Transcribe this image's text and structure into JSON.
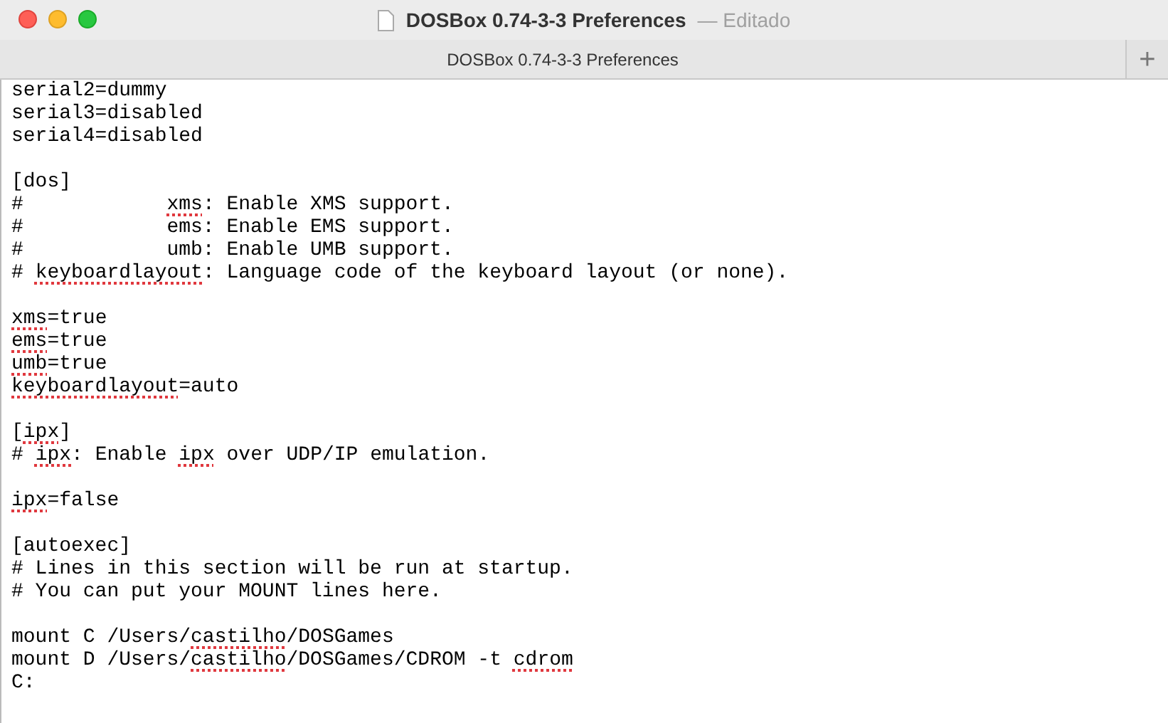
{
  "window": {
    "title": "DOSBox 0.74-3-3 Preferences",
    "edited_label": "— Editado"
  },
  "tabs": [
    {
      "label": "DOSBox 0.74-3-3 Preferences",
      "selected": true
    }
  ],
  "new_tab_button": "+",
  "editor": {
    "lines": [
      {
        "kind": "text",
        "segments": [
          {
            "text": "serial2=dummy",
            "misspelled": false
          }
        ]
      },
      {
        "kind": "text",
        "segments": [
          {
            "text": "serial3=disabled",
            "misspelled": false
          }
        ]
      },
      {
        "kind": "text",
        "segments": [
          {
            "text": "serial4=disabled",
            "misspelled": false
          }
        ]
      },
      {
        "kind": "blank"
      },
      {
        "kind": "text",
        "segments": [
          {
            "text": "[dos]",
            "misspelled": false
          }
        ]
      },
      {
        "kind": "text",
        "segments": [
          {
            "text": "#            ",
            "misspelled": false
          },
          {
            "text": "xms",
            "misspelled": true
          },
          {
            "text": ": Enable XMS support.",
            "misspelled": false
          }
        ]
      },
      {
        "kind": "text",
        "segments": [
          {
            "text": "#            ems: Enable EMS support.",
            "misspelled": false
          }
        ]
      },
      {
        "kind": "text",
        "segments": [
          {
            "text": "#            umb: Enable UMB support.",
            "misspelled": false
          }
        ]
      },
      {
        "kind": "text",
        "segments": [
          {
            "text": "# ",
            "misspelled": false
          },
          {
            "text": "keyboardlayout",
            "misspelled": true
          },
          {
            "text": ": Language code of the keyboard layout (or none).",
            "misspelled": false
          }
        ]
      },
      {
        "kind": "blank"
      },
      {
        "kind": "text",
        "segments": [
          {
            "text": "xms",
            "misspelled": true
          },
          {
            "text": "=true",
            "misspelled": false
          }
        ]
      },
      {
        "kind": "text",
        "segments": [
          {
            "text": "ems",
            "misspelled": true
          },
          {
            "text": "=true",
            "misspelled": false
          }
        ]
      },
      {
        "kind": "text",
        "segments": [
          {
            "text": "umb",
            "misspelled": true
          },
          {
            "text": "=true",
            "misspelled": false
          }
        ]
      },
      {
        "kind": "text",
        "segments": [
          {
            "text": "keyboardlayout",
            "misspelled": true
          },
          {
            "text": "=auto",
            "misspelled": false
          }
        ]
      },
      {
        "kind": "blank"
      },
      {
        "kind": "text",
        "segments": [
          {
            "text": "[",
            "misspelled": false
          },
          {
            "text": "ipx",
            "misspelled": true
          },
          {
            "text": "]",
            "misspelled": false
          }
        ]
      },
      {
        "kind": "text",
        "segments": [
          {
            "text": "# ",
            "misspelled": false
          },
          {
            "text": "ipx",
            "misspelled": true
          },
          {
            "text": ": Enable ",
            "misspelled": false
          },
          {
            "text": "ipx",
            "misspelled": true
          },
          {
            "text": " over UDP/IP emulation.",
            "misspelled": false
          }
        ]
      },
      {
        "kind": "blank"
      },
      {
        "kind": "text",
        "segments": [
          {
            "text": "ipx",
            "misspelled": true
          },
          {
            "text": "=false",
            "misspelled": false
          }
        ]
      },
      {
        "kind": "blank"
      },
      {
        "kind": "text",
        "segments": [
          {
            "text": "[autoexec]",
            "misspelled": false
          }
        ]
      },
      {
        "kind": "text",
        "segments": [
          {
            "text": "# Lines in this section will be run at startup.",
            "misspelled": false
          }
        ]
      },
      {
        "kind": "text",
        "segments": [
          {
            "text": "# You can put your MOUNT lines here.",
            "misspelled": false
          }
        ]
      },
      {
        "kind": "blank"
      },
      {
        "kind": "text",
        "segments": [
          {
            "text": "mount C /Users/",
            "misspelled": false
          },
          {
            "text": "castilho",
            "misspelled": true
          },
          {
            "text": "/DOSGames",
            "misspelled": false
          }
        ]
      },
      {
        "kind": "text",
        "segments": [
          {
            "text": "mount D /Users/",
            "misspelled": false
          },
          {
            "text": "castilho",
            "misspelled": true
          },
          {
            "text": "/DOSGames/CDROM -t ",
            "misspelled": false
          },
          {
            "text": "cdrom",
            "misspelled": true
          }
        ]
      },
      {
        "kind": "text",
        "segments": [
          {
            "text": "C:",
            "misspelled": false
          }
        ]
      }
    ]
  }
}
